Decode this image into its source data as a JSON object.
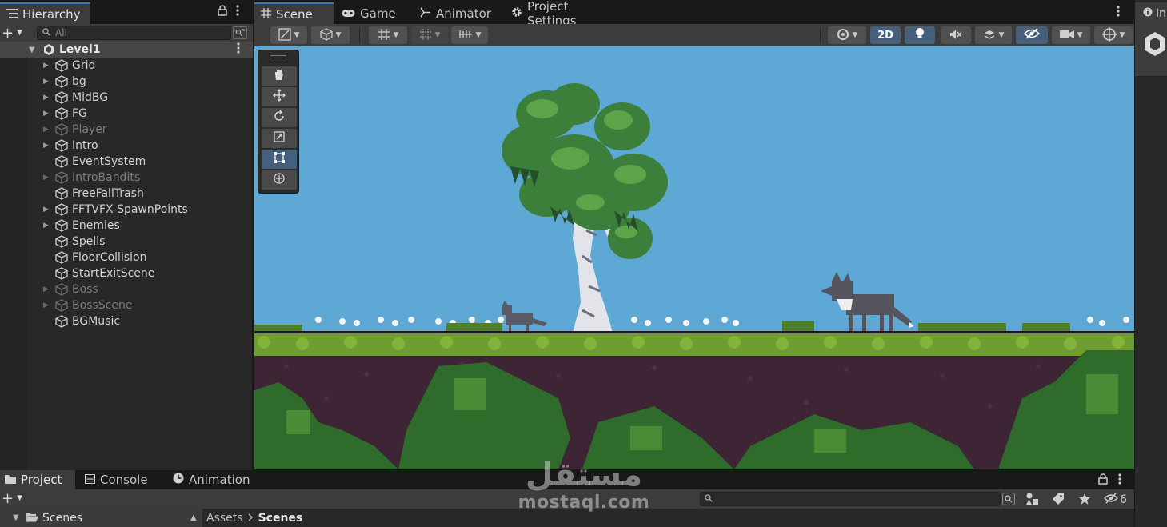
{
  "hierarchy": {
    "tab_label": "Hierarchy",
    "search_placeholder": "All",
    "scene_name": "Level1",
    "items": [
      {
        "label": "Grid",
        "expandable": true,
        "dimmed": false
      },
      {
        "label": "bg",
        "expandable": true,
        "dimmed": false
      },
      {
        "label": "MidBG",
        "expandable": true,
        "dimmed": false
      },
      {
        "label": "FG",
        "expandable": true,
        "dimmed": false
      },
      {
        "label": "Player",
        "expandable": true,
        "dimmed": true
      },
      {
        "label": "Intro",
        "expandable": true,
        "dimmed": false
      },
      {
        "label": "EventSystem",
        "expandable": false,
        "dimmed": false
      },
      {
        "label": "IntroBandits",
        "expandable": true,
        "dimmed": true
      },
      {
        "label": "FreeFallTrash",
        "expandable": false,
        "dimmed": false
      },
      {
        "label": "FFTVFX SpawnPoints",
        "expandable": true,
        "dimmed": false
      },
      {
        "label": "Enemies",
        "expandable": true,
        "dimmed": false
      },
      {
        "label": "Spells",
        "expandable": false,
        "dimmed": false
      },
      {
        "label": "FloorCollision",
        "expandable": false,
        "dimmed": false
      },
      {
        "label": "StartExitScene",
        "expandable": false,
        "dimmed": false
      },
      {
        "label": "Boss",
        "expandable": true,
        "dimmed": true
      },
      {
        "label": "BossScene",
        "expandable": true,
        "dimmed": true
      },
      {
        "label": "BGMusic",
        "expandable": false,
        "dimmed": false
      }
    ]
  },
  "scene_tabs": [
    {
      "label": "Scene",
      "icon": "grid-icon",
      "active": true
    },
    {
      "label": "Game",
      "icon": "gamepad-icon",
      "active": false
    },
    {
      "label": "Animator",
      "icon": "animator-icon",
      "active": false
    },
    {
      "label": "Project Settings",
      "icon": "gear-icon",
      "active": false
    }
  ],
  "scene_toolbar": {
    "mode_2d_label": "2D"
  },
  "scene_tools": [
    "hand-tool",
    "move-tool",
    "rotate-tool",
    "scale-tool",
    "rect-tool",
    "transform-tool"
  ],
  "active_tool": "rect-tool",
  "inspector": {
    "tab_label": "In"
  },
  "project_tabs": [
    {
      "label": "Project",
      "icon": "folder-icon",
      "active": true
    },
    {
      "label": "Console",
      "icon": "console-icon",
      "active": false
    },
    {
      "label": "Animation",
      "icon": "clock-icon",
      "active": false
    }
  ],
  "project": {
    "folder_label": "Scenes",
    "breadcrumb": [
      "Assets",
      "Scenes"
    ],
    "hidden_count": "6"
  },
  "watermark": {
    "arabic": "مستقل",
    "latin": "mostaql.com"
  },
  "colors": {
    "sky": "#5ea8d6",
    "grass": "#6d9a2e",
    "dirt": "#3d2535",
    "foliage": "#2f6b2b",
    "accent_blue": "#3a79bb"
  }
}
